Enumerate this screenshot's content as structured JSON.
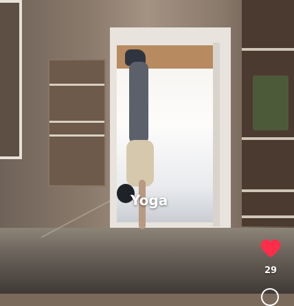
{
  "video": {
    "hashtag": "Yoga",
    "likes": "29"
  },
  "icons": {
    "like": "heart-icon",
    "comment": "comment-icon"
  },
  "colors": {
    "like_color": "#ff2d4a"
  }
}
